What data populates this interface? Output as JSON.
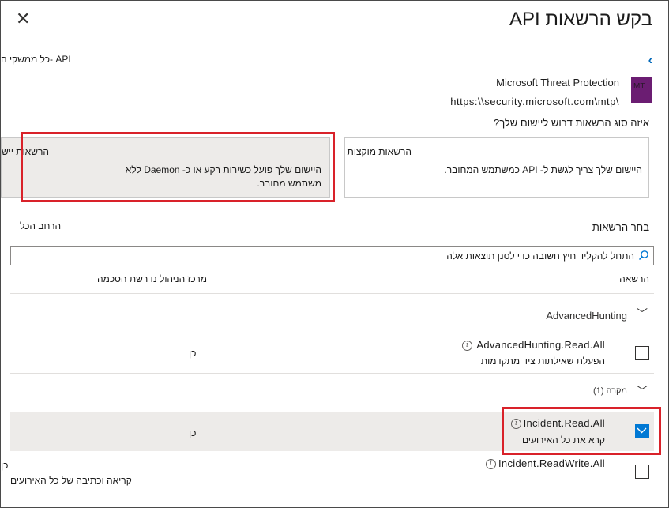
{
  "panel": {
    "title": "בקש הרשאות API",
    "breadcrumb": "API -כל ממשקי ה",
    "close_symbol": "✕"
  },
  "app": {
    "name": "Microsoft Threat Protection",
    "url": "https:\\\\security.microsoft.com\\mtp\\",
    "logo_text": "MT",
    "logo_color": "#6b1d72"
  },
  "permission_type": {
    "question": "איזה סוג הרשאות דרוש ליישום שלך?",
    "delegated": {
      "title": "הרשאות מוקצות",
      "description": "היישום שלך צריך לגשת ל- API כמשתמש המחובר."
    },
    "application": {
      "title": "הרשאות יישום",
      "description_line1": "היישום שלך פועל כשירות רקע או כ- Daemon ללא",
      "description_line2": "משתמש מחובר."
    }
  },
  "select_permissions": {
    "label": "בחר הרשאות",
    "expand_all": "הרחב הכל",
    "search_placeholder": "התחל להקליד חיץ חשובה כדי לסנן תוצאות אלה"
  },
  "columns": {
    "permission": "הרשאה",
    "admin_consent": "מרכז הניהול נדרשת הסכמה"
  },
  "groups": [
    {
      "name": "AdvancedHunting",
      "permissions": [
        {
          "name": "AdvancedHunting.Read.All",
          "description": "הפעלת שאילתות ציד מתקדמות",
          "admin_consent": "כן",
          "checked": false
        }
      ]
    },
    {
      "name": "מקרה (1)",
      "permissions": [
        {
          "name": "Incident.Read.All",
          "description": "קרא את כל האירועים",
          "admin_consent": "כן",
          "checked": true
        },
        {
          "name": "Incident.ReadWrite.All",
          "description": "קריאה וכתיבה של כל האירועים",
          "admin_consent": "כן",
          "checked": false
        }
      ]
    }
  ],
  "colors": {
    "accent": "#0078d4",
    "highlight": "#d9222a",
    "selected_bg": "#edebe9"
  }
}
